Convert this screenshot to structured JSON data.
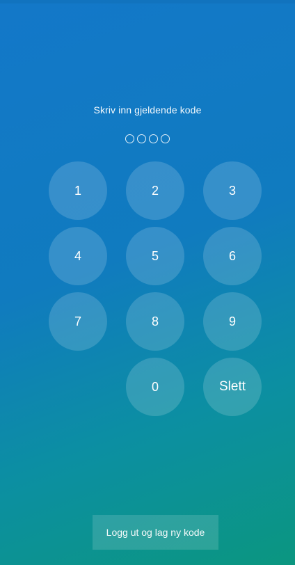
{
  "lock_screen": {
    "prompt": "Skriv inn gjeldende kode",
    "pin_length": 4,
    "keys": [
      "1",
      "2",
      "3",
      "4",
      "5",
      "6",
      "7",
      "8",
      "9",
      "",
      "0",
      "Slett"
    ],
    "logout_label": "Logg ut og lag ny kode"
  },
  "colors": {
    "gradient_top": "#1378c9",
    "gradient_bottom": "#0b9680",
    "text": "#ffffff"
  }
}
